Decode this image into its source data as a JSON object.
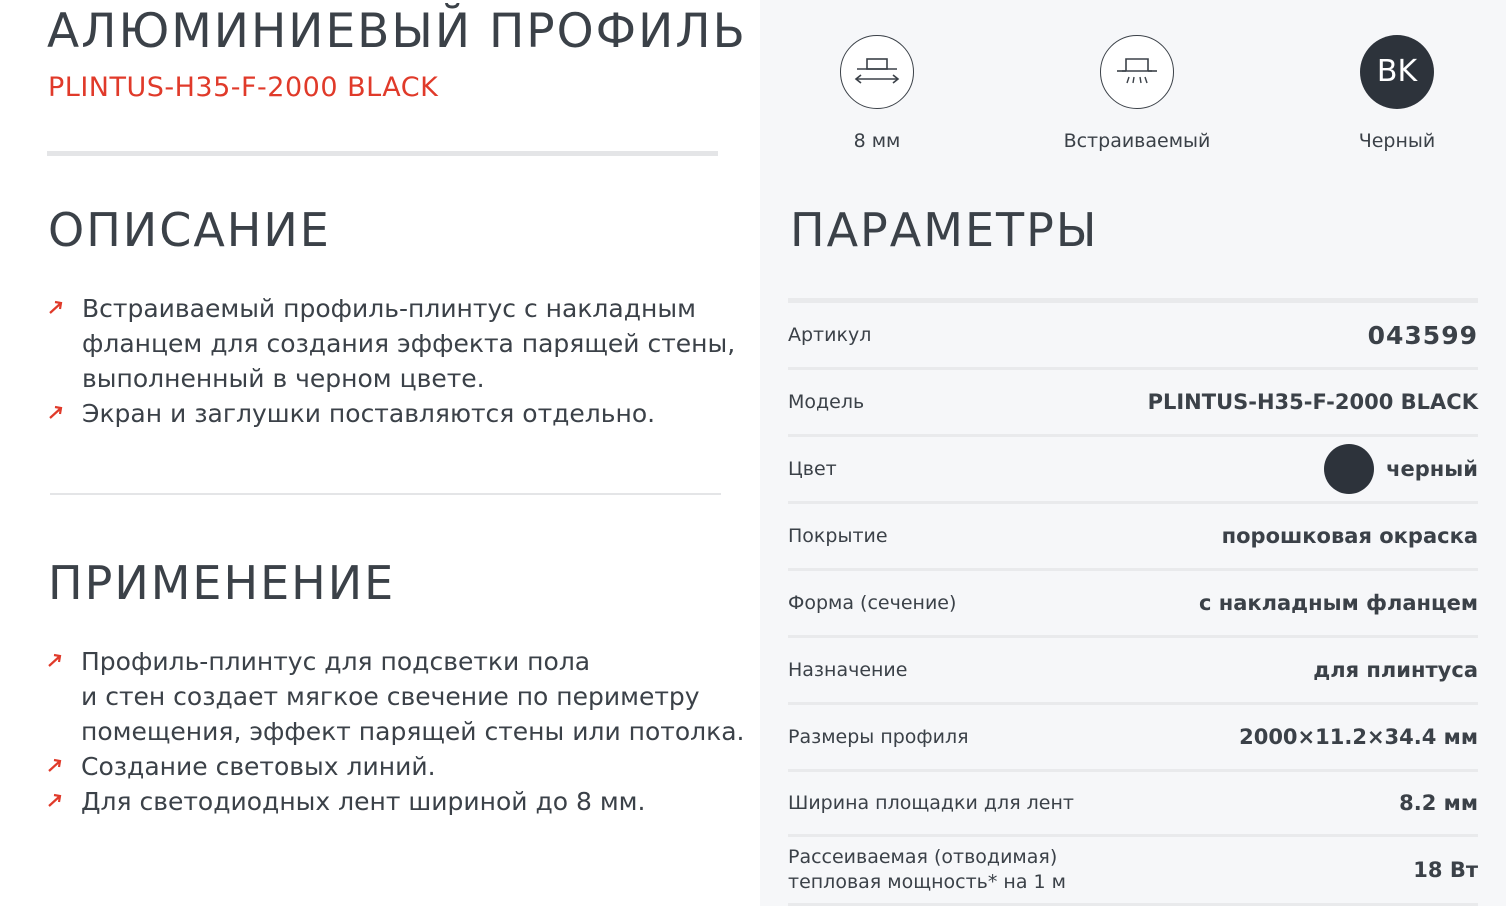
{
  "product": {
    "title": "АЛЮМИНИЕВЫЙ ПРОФИЛЬ",
    "subtitle": "PLINTUS-H35-F-2000 BLACK"
  },
  "description": {
    "heading": "ОПИСАНИЕ",
    "items": [
      "Встраиваемый профиль-плинтус с накладным\nфланцем для создания эффекта парящей стены,\nвыполненный в черном цвете.",
      "Экран и заглушки поставляются отдельно."
    ]
  },
  "application": {
    "heading": "ПРИМЕНЕНИЕ",
    "items": [
      "Профиль-плинтус для подсветки пола\nи стен создает мягкое свечение по периметру\nпомещения, эффект парящей стены или потолка.",
      "Создание световых линий.",
      "Для светодиодных лент шириной до 8 мм."
    ]
  },
  "features": [
    {
      "icon": "width-arrows-icon",
      "label": "8 мм"
    },
    {
      "icon": "recessed-light-icon",
      "label": "Встраиваемый"
    },
    {
      "icon": "color-code-badge",
      "code": "BK",
      "label": "Черный"
    }
  ],
  "parameters": {
    "heading": "ПАРАМЕТРЫ",
    "rows": [
      {
        "key": "Артикул",
        "value": "043599"
      },
      {
        "key": "Модель",
        "value": "PLINTUS-H35-F-2000 BLACK"
      },
      {
        "key": "Цвет",
        "value": "черный",
        "swatch_color": "#2d333b"
      },
      {
        "key": "Покрытие",
        "value": "порошковая окраска"
      },
      {
        "key": "Форма (сечение)",
        "value": "с накладным фланцем"
      },
      {
        "key": "Назначение",
        "value": "для плинтуса"
      },
      {
        "key": "Размеры профиля",
        "value": "2000×11.2×34.4 мм"
      },
      {
        "key": "Ширина площадки для лент",
        "value": "8.2 мм"
      },
      {
        "key": "Рассеиваемая (отводимая)\nтепловая мощность* на 1 м",
        "value": "18 Вт"
      }
    ]
  },
  "colors": {
    "accent": "#e03a2a",
    "text": "#3b4148",
    "panel": "#f6f7f9",
    "swatch": "#2d333b"
  }
}
